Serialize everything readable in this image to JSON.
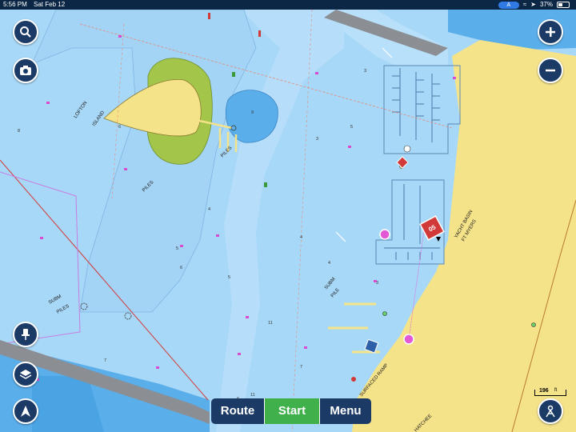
{
  "status": {
    "time": "5:56 PM",
    "date": "Sat Feb 12",
    "battery": "37%"
  },
  "map_labels": {
    "lofton": "LOFTON",
    "island": "ISLAND",
    "piles_1": "PILES",
    "piles_2": "PILES",
    "subm_piles_1": "SUBM",
    "subm_piles_2": "PILES",
    "subm_pile_1": "SUBM",
    "subm_pile_2": "PILE",
    "yacht_basin_1": "YACHT BASIN",
    "yacht_basin_2": "FT MYERS",
    "surfaced_ramp": "SURFACED RAMP",
    "hatchee": "HATCHEE",
    "marker": "05"
  },
  "soundings": [
    "8",
    "6",
    "5",
    "5",
    "9",
    "3",
    "3",
    "5",
    "4",
    "11",
    "6",
    "4",
    "4",
    "7",
    "7",
    "6",
    "3",
    "11"
  ],
  "bottom_bar": {
    "route_label": "Route",
    "start_label": "Start",
    "menu_label": "Menu"
  },
  "scale": {
    "value": "196",
    "unit": "ft"
  },
  "icons": {
    "search": "search-icon",
    "camera": "camera-icon",
    "zoom_in": "plus-icon",
    "zoom_out": "minus-icon",
    "pin": "pin-icon",
    "layers": "layers-icon",
    "north": "compass-arrow-icon",
    "user": "person-icon"
  },
  "colors": {
    "water_shallow": "#a8d8f7",
    "water_deep": "#5aaeea",
    "land": "#f5e38a",
    "green_marsh": "#a3c54a",
    "ui_dark": "#1b3a66",
    "start_green": "#3fb04a"
  }
}
